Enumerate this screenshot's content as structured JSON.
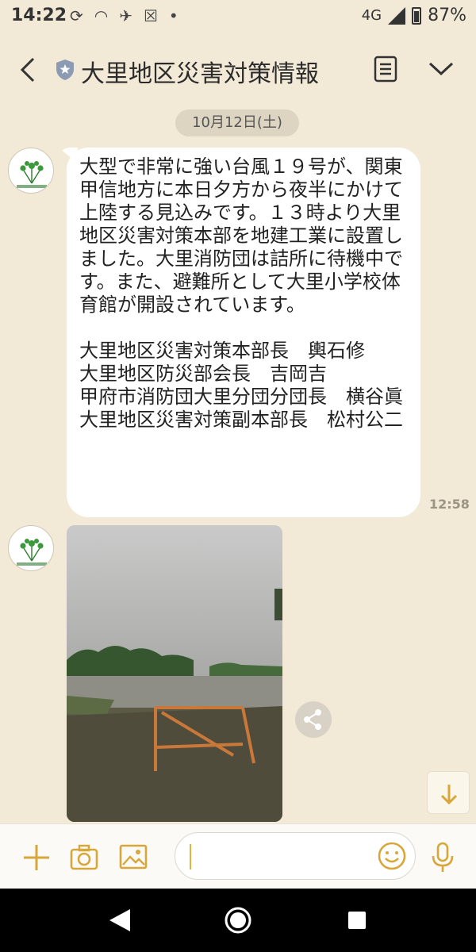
{
  "status_bar": {
    "time": "14:22",
    "network": "4G",
    "battery": "87%"
  },
  "header": {
    "title": "大里地区災害対策情報",
    "icons": [
      "back-chevron-icon",
      "official-shield-icon",
      "notes-icon",
      "chevron-down-icon"
    ]
  },
  "date_label": "10月12日(土)",
  "message": {
    "paragraphs": [
      "大型で非常に強い台風１９号が、関東甲信地方に本日夕方から夜半にかけて上陸する見込みです。１３時より大里地区災害対策本部を地建工業に設置しました。大里消防団は詰所に待機中です。また、避難所として大里小学校体育館が開設されています。",
      "大里地区災害対策本部長　輿石修\n大里地区防災部会長　吉岡吉\n甲府市消防団大里分団分団長　横谷眞\n大里地区災害対策副本部長　松村公二"
    ],
    "time": "12:58"
  },
  "avatar": {
    "name": "大里地区災害情報"
  },
  "input": {
    "value": "",
    "placeholder": ""
  },
  "colors": {
    "background": "#f2ead7",
    "bubble": "#ffffff",
    "accent": "#e3b43c"
  }
}
